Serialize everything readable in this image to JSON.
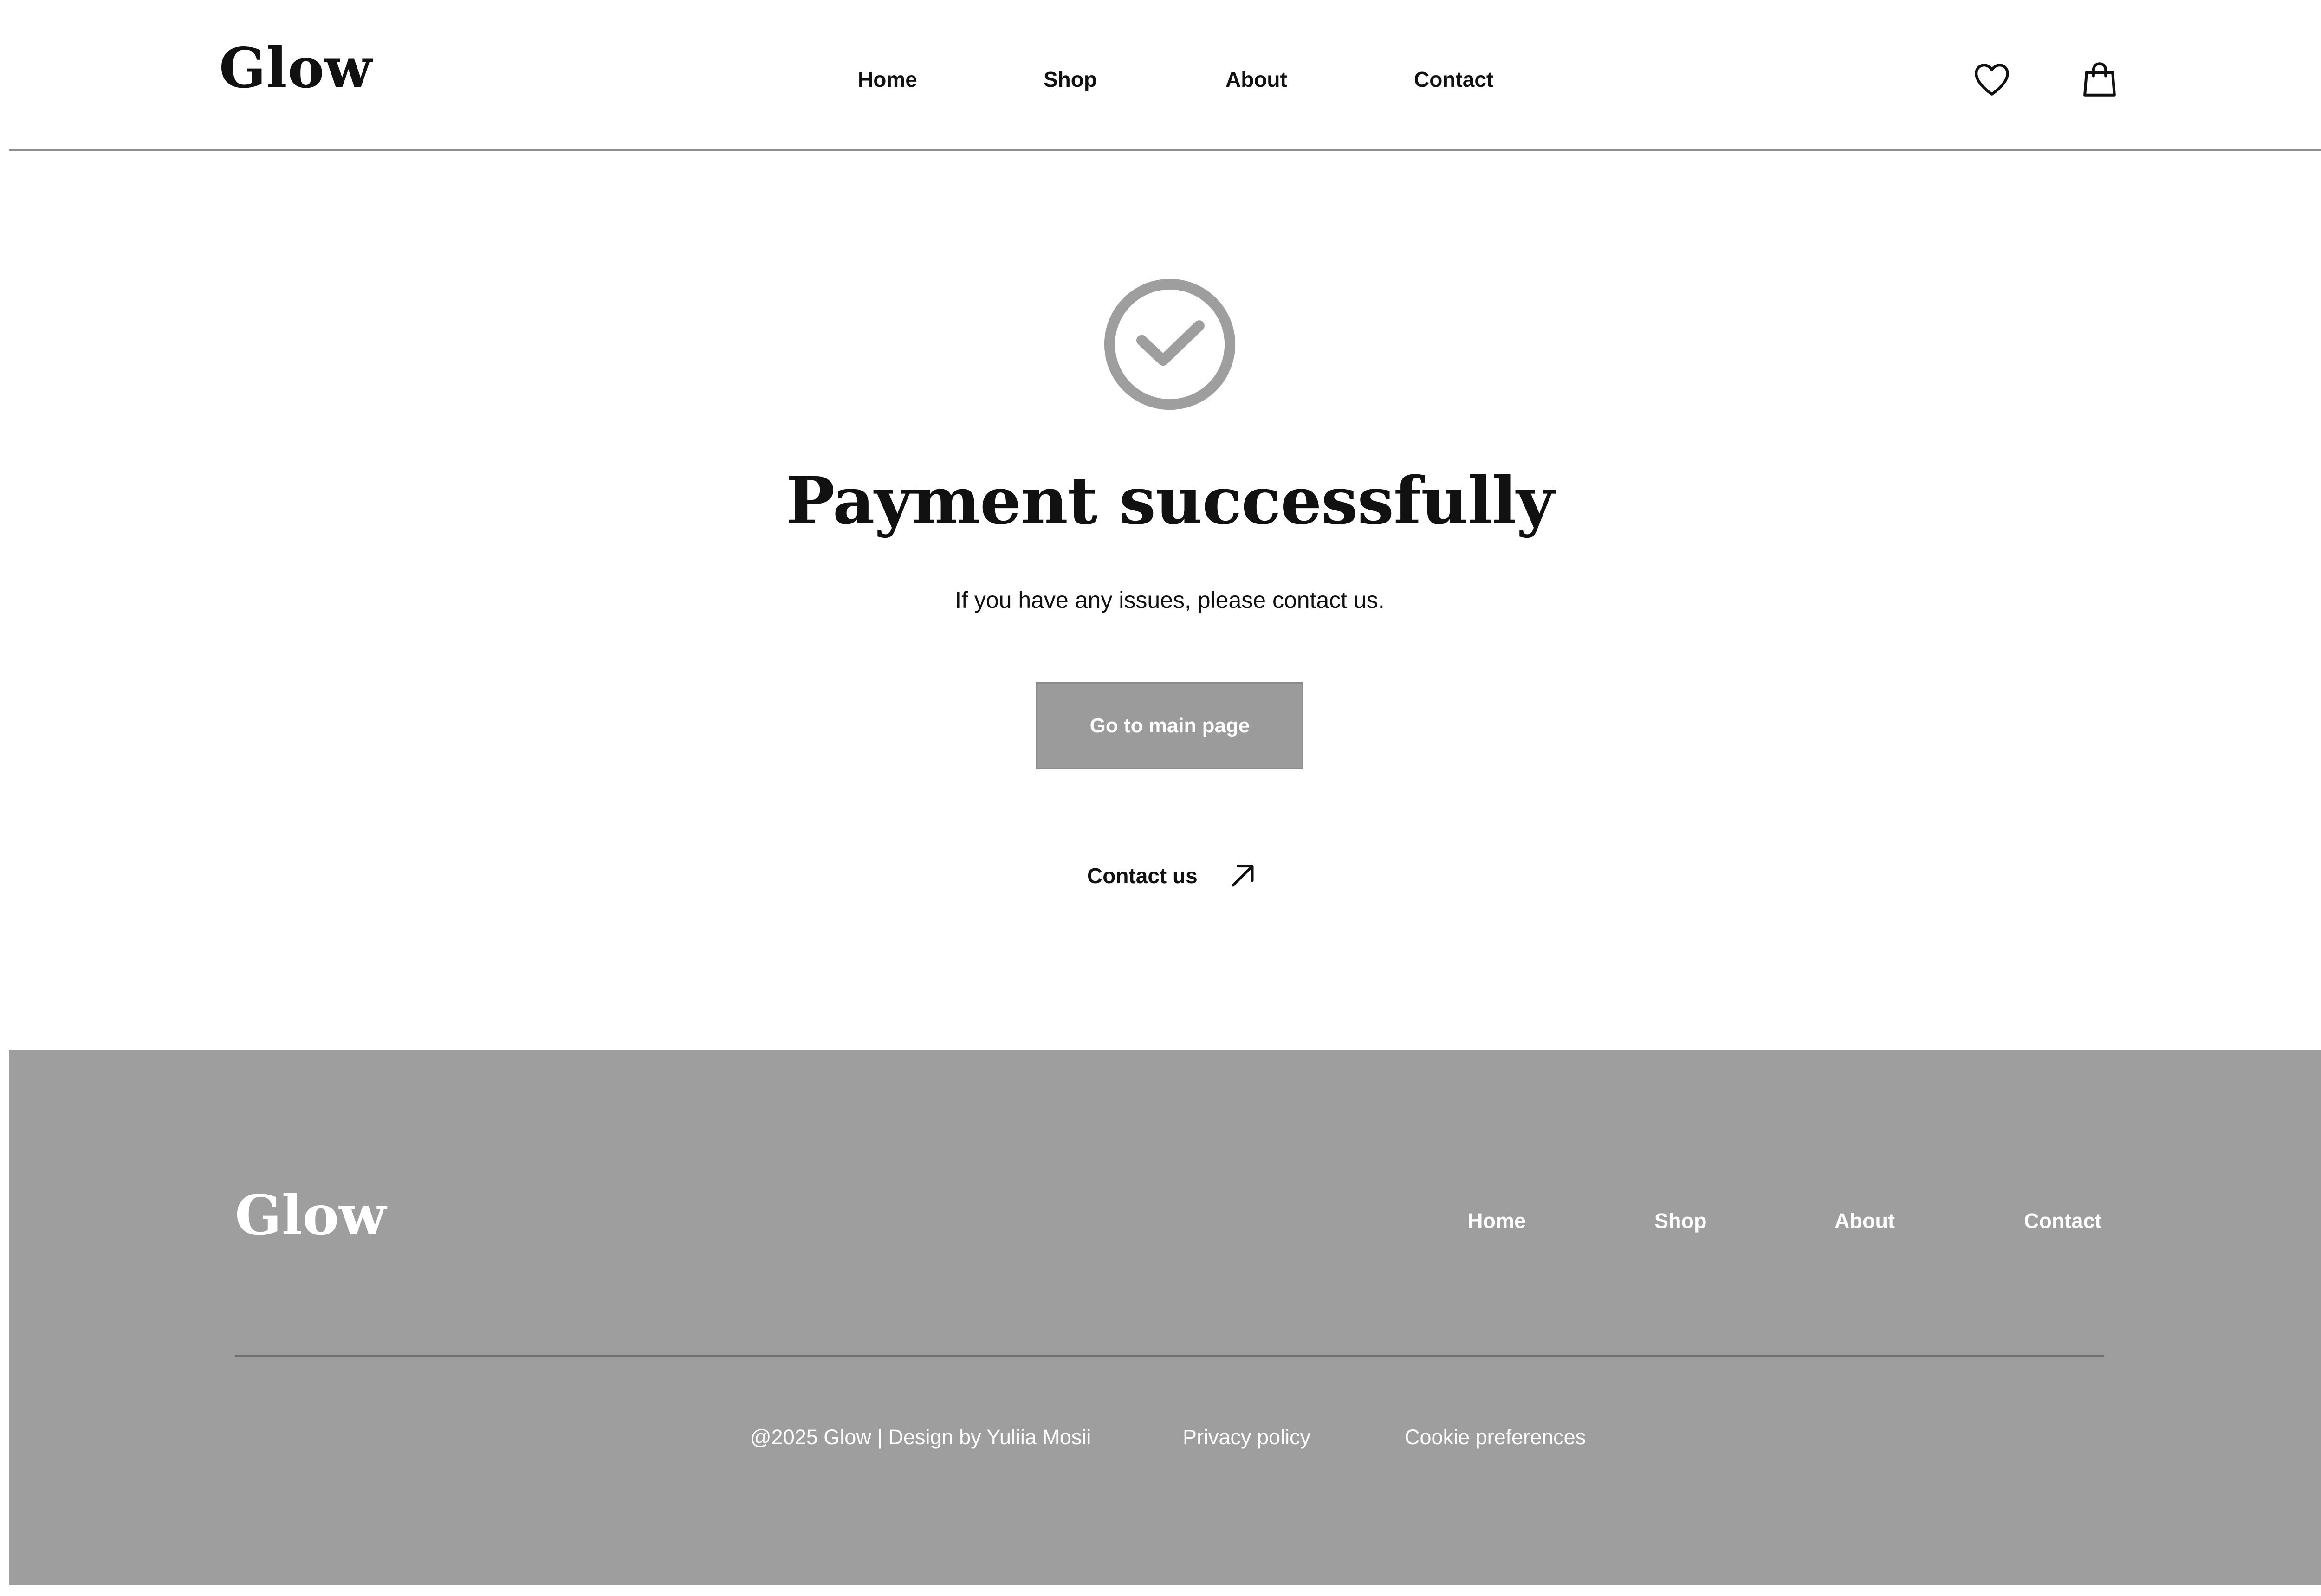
{
  "header": {
    "logo": "Glow",
    "nav": [
      {
        "label": "Home"
      },
      {
        "label": "Shop"
      },
      {
        "label": "About"
      },
      {
        "label": "Contact"
      }
    ],
    "icons": [
      "heart-icon",
      "shopping-bag-icon"
    ]
  },
  "main": {
    "status_icon": "check-circle-icon",
    "title": "Payment successfully",
    "subtitle": "If you have any issues, please contact us.",
    "button_label": "Go to main page",
    "contact_link_label": "Contact us",
    "contact_link_icon": "arrow-up-right-icon"
  },
  "footer": {
    "logo": "Glow",
    "nav": [
      {
        "label": "Home"
      },
      {
        "label": "Shop"
      },
      {
        "label": "About"
      },
      {
        "label": "Contact"
      }
    ],
    "copyright": "@2025 Glow | Design by Yuliia Mosii",
    "privacy_label": "Privacy policy",
    "cookies_label": "Cookie preferences"
  },
  "colors": {
    "text": "#111111",
    "accent_gray": "#9e9e9e",
    "button_gray": "#9b9b9b",
    "divider": "#8f8f8f",
    "white": "#ffffff"
  }
}
